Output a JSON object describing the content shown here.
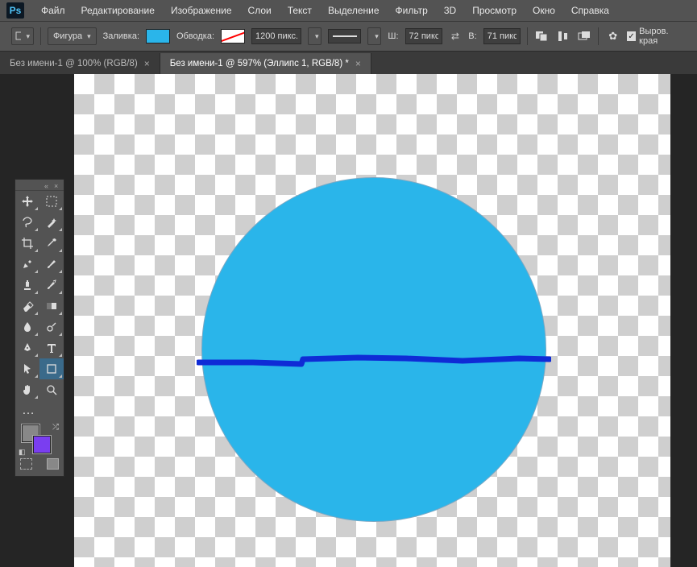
{
  "app": {
    "logo": "Ps"
  },
  "menu": {
    "file": "Файл",
    "edit": "Редактирование",
    "image": "Изображение",
    "layer": "Слои",
    "text": "Текст",
    "select": "Выделение",
    "filter": "Фильтр",
    "threeD": "3D",
    "view": "Просмотр",
    "window": "Окно",
    "help": "Справка"
  },
  "options": {
    "mode_label": "Фигура",
    "fill_label": "Заливка:",
    "stroke_label": "Обводка:",
    "stroke_width": "1200 пикс.",
    "w_label": "Ш:",
    "w_value": "72 пикс",
    "h_label": "В:",
    "h_value": "71 пикс",
    "align_edges_label": "Выров. края",
    "fill_color": "#2ab5ea",
    "stroke_color": "none"
  },
  "tabs": [
    {
      "label": "Без имени-1 @ 100% (RGB/8)",
      "active": false
    },
    {
      "label": "Без имени-1 @ 597% (Эллипс 1, RGB/8) *",
      "active": true
    }
  ],
  "tools": {
    "move": "move",
    "marquee": "marquee",
    "lasso": "lasso",
    "wand": "wand",
    "crop": "crop",
    "eyedropper": "eyedropper",
    "healing": "healing",
    "brush": "brush",
    "stamp": "stamp",
    "history": "history",
    "eraser": "eraser",
    "gradient": "gradient",
    "blur": "blur",
    "dodge": "dodge",
    "pen": "pen",
    "type": "type",
    "path": "path",
    "shape": "shape",
    "hand": "hand",
    "zoom": "zoom",
    "more": "…"
  },
  "colors": {
    "fg": "#888888",
    "bg": "#7a3ef0"
  },
  "canvas": {
    "ellipse_fill": "#2ab5ea",
    "line_color": "#0f2bd6"
  }
}
